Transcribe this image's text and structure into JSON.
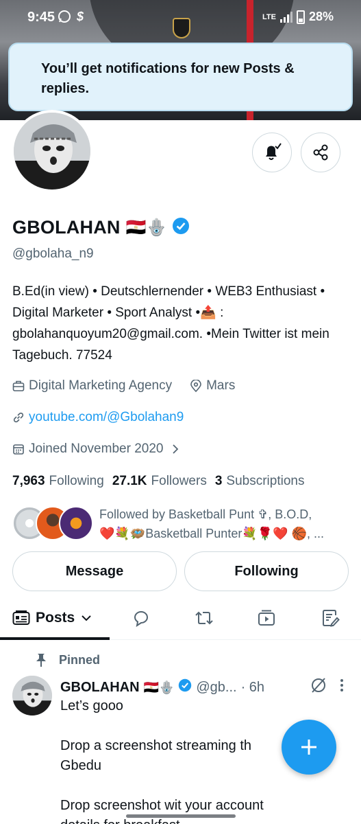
{
  "status_bar": {
    "time": "9:45",
    "network": "LTE",
    "battery": "28%"
  },
  "toast": {
    "text": "You’ll get notifications for new Posts & replies."
  },
  "profile": {
    "name": "GBOLAHAN",
    "name_emojis": "🇪🇬🪬",
    "handle": "@gbolaha_n9",
    "bio": "B.Ed(in view) • Deutschlernender • WEB3 Enthusiast • Digital Marketer • Sport Analyst •📤 : gbolahanquoyum20@gmail.com. •Mein Twitter ist mein Tagebuch.  77524",
    "category": "Digital Marketing Agency",
    "location": "Mars",
    "website": "youtube.com/@Gbolahan9",
    "joined": "Joined November 2020"
  },
  "stats": {
    "following_count": "7,963",
    "following_label": "Following",
    "followers_count": "27.1K",
    "followers_label": "Followers",
    "subscriptions_count": "3",
    "subscriptions_label": "Subscriptions"
  },
  "followed_by": {
    "line1": "Followed by Basketball Punt ✞, B.O.D,",
    "line2": "❤️💐🪺Basketball Punter💐🌹❤️ 🏀, ..."
  },
  "buttons": {
    "message": "Message",
    "following": "Following"
  },
  "tabs": {
    "posts": "Posts"
  },
  "pinned_label": "Pinned",
  "tweet": {
    "name": "GBOLAHAN",
    "emojis": "🇪🇬🪬",
    "handle": "@gb...",
    "time": "· 6h",
    "line1": "Let’s gooo",
    "line2": "Drop a screenshot streaming th",
    "line3": "Gbedu",
    "line4": "Drop screenshot wit your account",
    "line5": "details for breakfast"
  },
  "colors": {
    "accent": "#1d9bf0",
    "text": "#0f1419",
    "secondary": "#536471",
    "toast_bg": "#e1f2fb"
  }
}
